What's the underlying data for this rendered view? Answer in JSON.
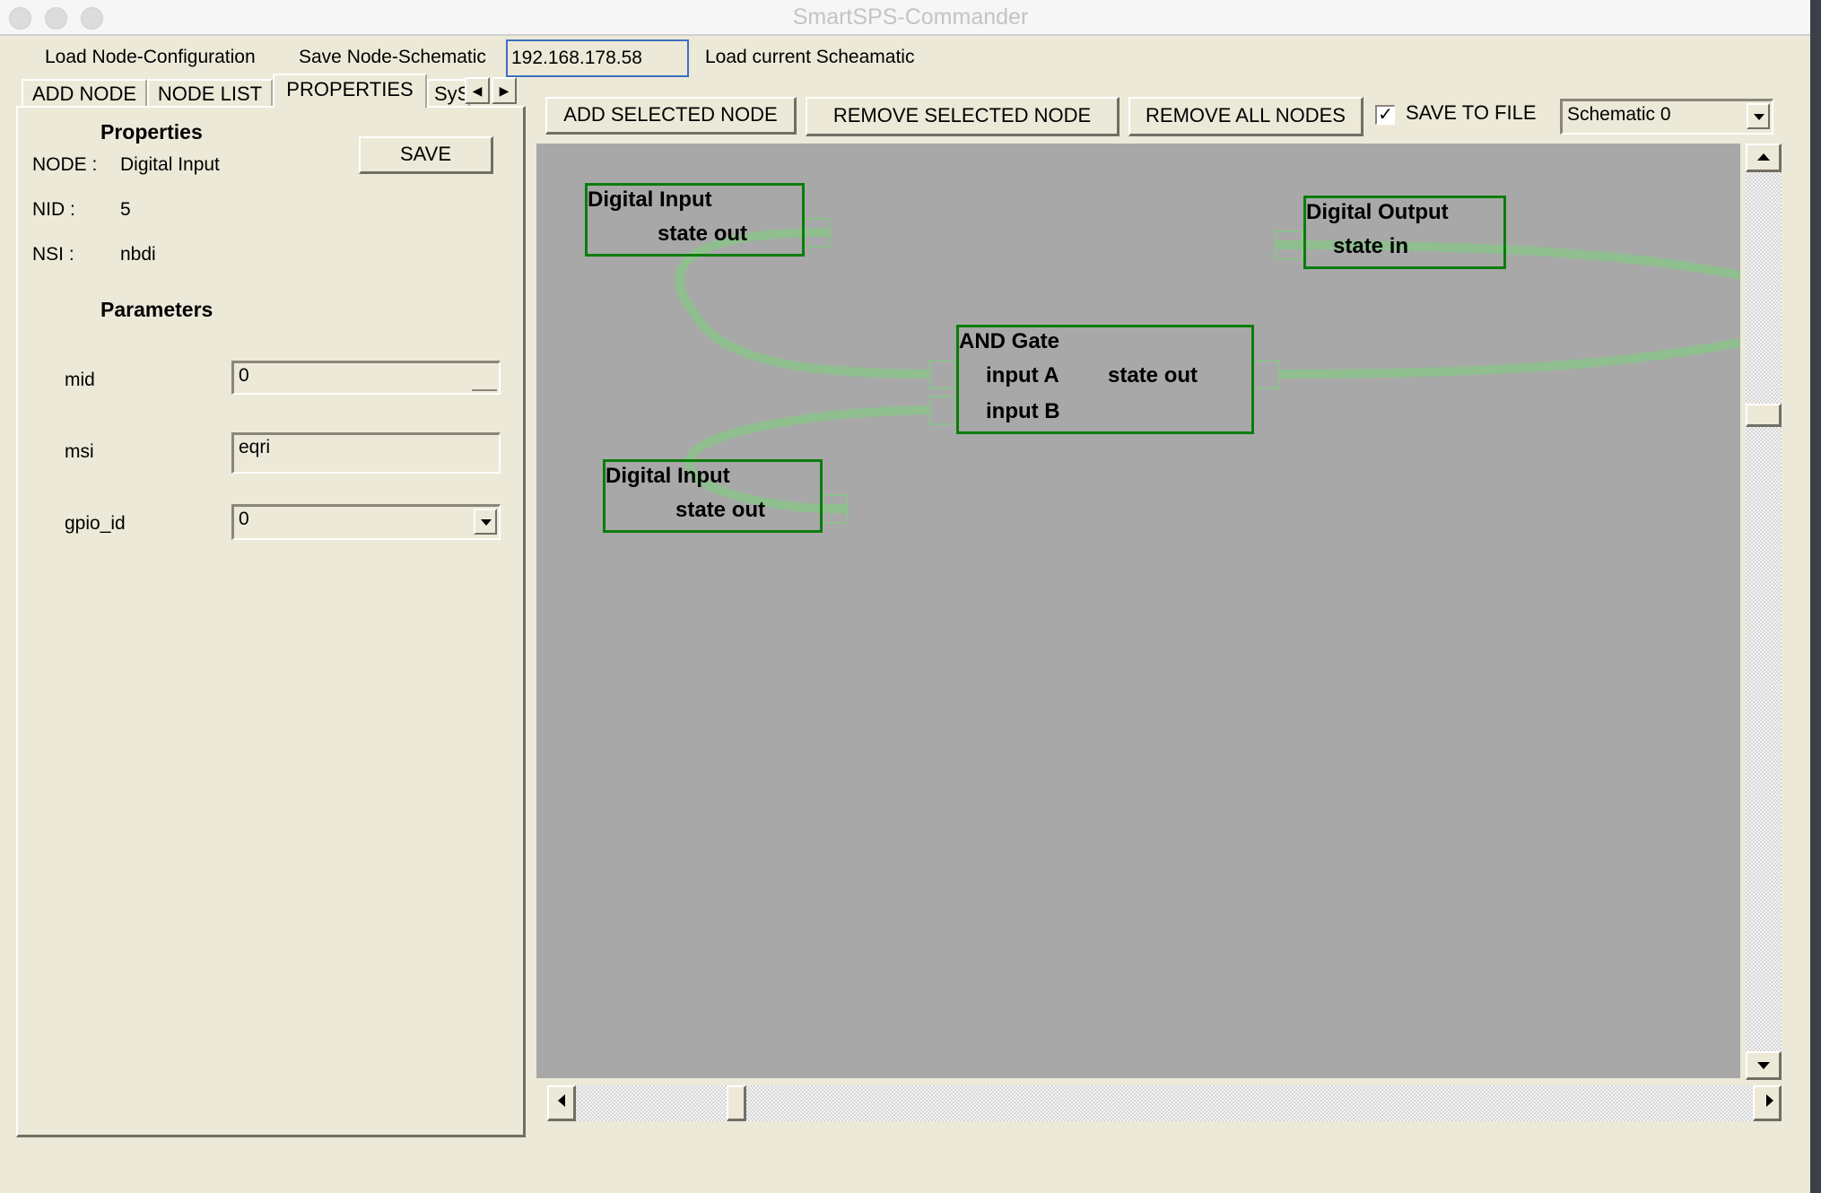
{
  "window": {
    "title": "SmartSPS-Commander"
  },
  "menu": {
    "load_config": "Load Node-Configuration",
    "save_schematic": "Save Node-Schematic",
    "ip_address": "192.168.178.58",
    "load_current": "Load current Scheamatic"
  },
  "tabs": [
    {
      "label": "ADD NODE",
      "active": false
    },
    {
      "label": "NODE LIST",
      "active": false
    },
    {
      "label": "PROPERTIES",
      "active": true
    },
    {
      "label": "SyS",
      "active": false
    }
  ],
  "properties": {
    "heading": "Properties",
    "save_label": "SAVE",
    "node_label": "NODE :",
    "node_value": "Digital Input",
    "nid_label": "NID :",
    "nid_value": "5",
    "nsi_label": "NSI :",
    "nsi_value": "nbdi",
    "params_heading": "Parameters",
    "params": [
      {
        "name": "mid",
        "value": "0",
        "type": "spinner"
      },
      {
        "name": "msi",
        "value": "eqri",
        "type": "text"
      },
      {
        "name": "gpio_id",
        "value": "0",
        "type": "dropdown"
      }
    ]
  },
  "toolbar": {
    "add_selected": "ADD SELECTED NODE",
    "remove_selected": "REMOVE SELECTED NODE",
    "remove_all": "REMOVE ALL NODES",
    "save_to_file_label": "SAVE TO FILE",
    "save_to_file_checked": true,
    "schematic_selected": "Schematic 0"
  },
  "schematic": {
    "wire_color": "#8fbf8f",
    "node_border_color": "#0a7d0a",
    "canvas_color": "#a8a8a8",
    "nodes": [
      {
        "id": "di1",
        "title": "Digital Input",
        "outputs": [
          "state  out"
        ]
      },
      {
        "id": "do1",
        "title": "Digital Output",
        "inputs": [
          "state  in"
        ]
      },
      {
        "id": "and1",
        "title": "AND Gate",
        "inputs": [
          "input A",
          "input B"
        ],
        "outputs": [
          "state  out"
        ]
      },
      {
        "id": "di2",
        "title": "Digital Input",
        "outputs": [
          "state  out"
        ]
      }
    ],
    "connections": [
      {
        "from": "di1.state_out",
        "to": "and1.input_A"
      },
      {
        "from": "di2.state_out",
        "to": "and1.input_B"
      },
      {
        "from": "and1.state_out",
        "to": "off-canvas-right"
      },
      {
        "from": "off-canvas-right",
        "to": "do1.state_in"
      }
    ]
  },
  "scroll": {
    "vertical_position": 0.27,
    "horizontal_position": 0.13
  }
}
